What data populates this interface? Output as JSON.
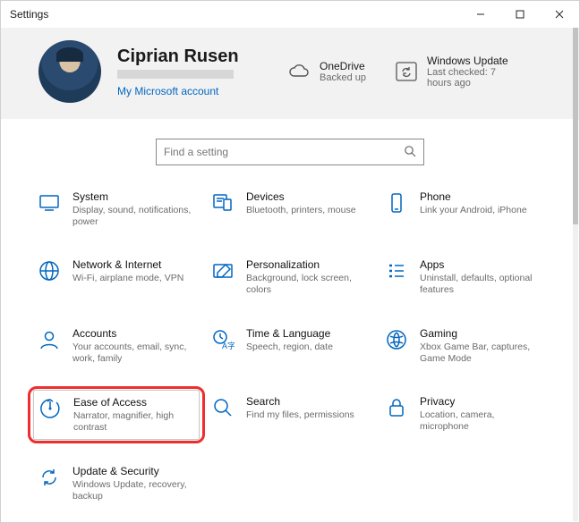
{
  "window": {
    "title": "Settings"
  },
  "user": {
    "name": "Ciprian Rusen",
    "link": "My Microsoft account"
  },
  "status": {
    "onedrive": {
      "title": "OneDrive",
      "sub": "Backed up"
    },
    "update": {
      "title": "Windows Update",
      "sub": "Last checked: 7 hours ago"
    }
  },
  "search": {
    "placeholder": "Find a setting"
  },
  "tiles": {
    "system": {
      "title": "System",
      "sub": "Display, sound, notifications, power"
    },
    "devices": {
      "title": "Devices",
      "sub": "Bluetooth, printers, mouse"
    },
    "phone": {
      "title": "Phone",
      "sub": "Link your Android, iPhone"
    },
    "network": {
      "title": "Network & Internet",
      "sub": "Wi-Fi, airplane mode, VPN"
    },
    "personalization": {
      "title": "Personalization",
      "sub": "Background, lock screen, colors"
    },
    "apps": {
      "title": "Apps",
      "sub": "Uninstall, defaults, optional features"
    },
    "accounts": {
      "title": "Accounts",
      "sub": "Your accounts, email, sync, work, family"
    },
    "time": {
      "title": "Time & Language",
      "sub": "Speech, region, date"
    },
    "gaming": {
      "title": "Gaming",
      "sub": "Xbox Game Bar, captures, Game Mode"
    },
    "ease": {
      "title": "Ease of Access",
      "sub": "Narrator, magnifier, high contrast"
    },
    "search_tile": {
      "title": "Search",
      "sub": "Find my files, permissions"
    },
    "privacy": {
      "title": "Privacy",
      "sub": "Location, camera, microphone"
    },
    "updatesec": {
      "title": "Update & Security",
      "sub": "Windows Update, recovery, backup"
    }
  }
}
